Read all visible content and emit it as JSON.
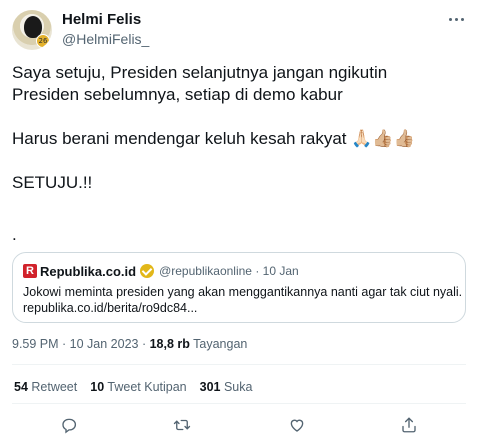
{
  "user": {
    "display_name": "Helmi Felis",
    "handle": "@HelmiFelis_",
    "avatar_badge": "26"
  },
  "tweet": {
    "line1": "Saya setuju, Presiden selanjutnya jangan ngikutin",
    "line2": "Presiden sebelumnya, setiap di demo kabur",
    "line3": "Harus berani mendengar keluh kesah rakyat 🙏🏻👍🏼👍🏼",
    "line4": "SETUJU.!!",
    "line5": "."
  },
  "quote": {
    "logo_letter": "R",
    "source_name": "Republika.co.id",
    "source_handle": "@republikaonline · 10 Jan",
    "text_line1": "Jokowi meminta presiden yang akan menggantikannya nanti agar tak ciut nyali.",
    "text_line2": "republika.co.id/berita/ro9dc84..."
  },
  "meta": {
    "timestamp": "9.59 PM · 10 Jan 2023 · ",
    "views_count": "18,8 rb",
    "views_label": " Tayangan"
  },
  "stats": {
    "retweets_count": "54",
    "retweets_label": " Retweet",
    "quotes_count": "10",
    "quotes_label": " Tweet Kutipan",
    "likes_count": "301",
    "likes_label": " Suka"
  },
  "icons": {
    "reply": "reply-icon",
    "retweet": "retweet-icon",
    "like": "heart-icon",
    "share": "share-icon",
    "more": "more-icon",
    "verified": "verified-icon"
  },
  "colors": {
    "text": "#0f1419",
    "secondary": "#536471",
    "border": "#cfd9de",
    "republika_red": "#d1222b",
    "verified_gold": "#e2b719"
  }
}
